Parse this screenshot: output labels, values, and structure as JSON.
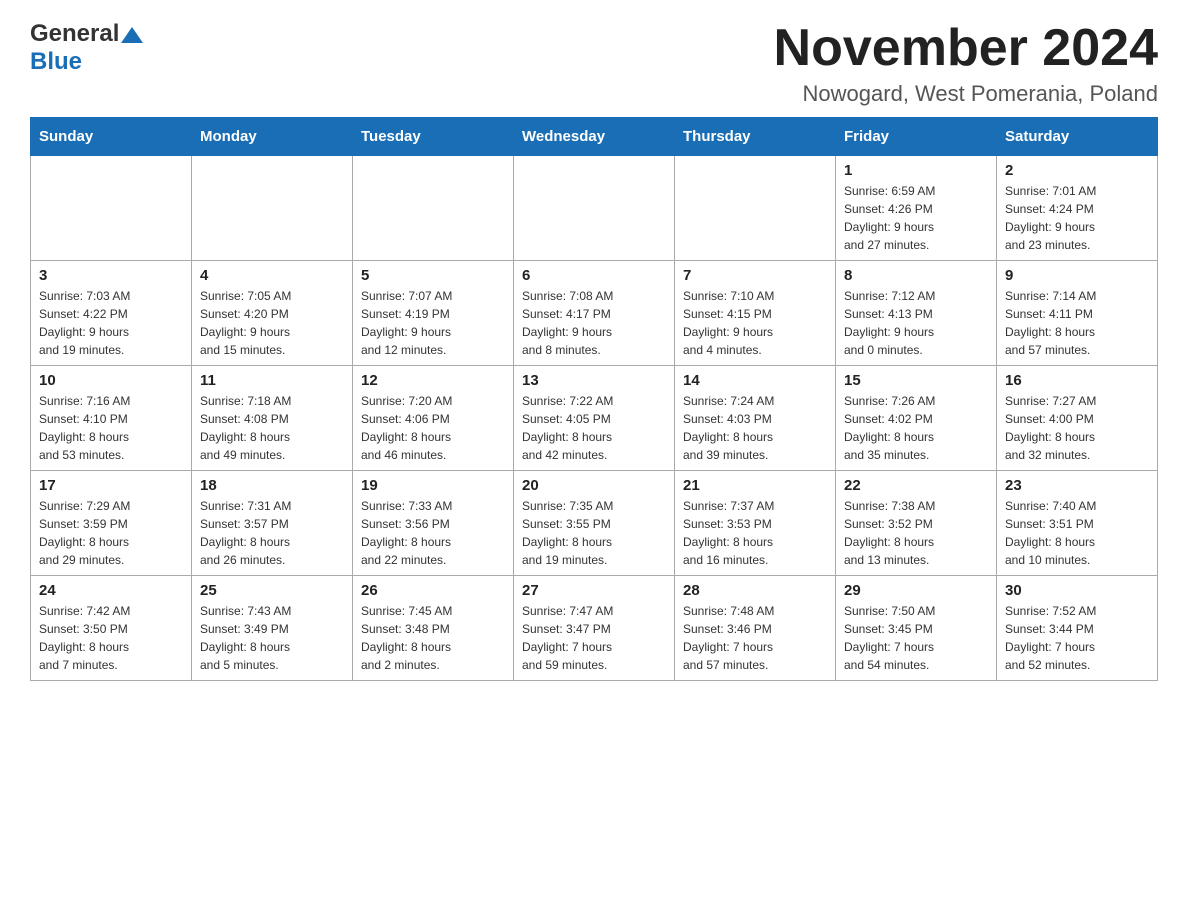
{
  "header": {
    "logo_general": "General",
    "logo_blue": "Blue",
    "main_title": "November 2024",
    "subtitle": "Nowogard, West Pomerania, Poland"
  },
  "weekdays": [
    "Sunday",
    "Monday",
    "Tuesday",
    "Wednesday",
    "Thursday",
    "Friday",
    "Saturday"
  ],
  "weeks": [
    [
      {
        "day": "",
        "info": ""
      },
      {
        "day": "",
        "info": ""
      },
      {
        "day": "",
        "info": ""
      },
      {
        "day": "",
        "info": ""
      },
      {
        "day": "",
        "info": ""
      },
      {
        "day": "1",
        "info": "Sunrise: 6:59 AM\nSunset: 4:26 PM\nDaylight: 9 hours\nand 27 minutes."
      },
      {
        "day": "2",
        "info": "Sunrise: 7:01 AM\nSunset: 4:24 PM\nDaylight: 9 hours\nand 23 minutes."
      }
    ],
    [
      {
        "day": "3",
        "info": "Sunrise: 7:03 AM\nSunset: 4:22 PM\nDaylight: 9 hours\nand 19 minutes."
      },
      {
        "day": "4",
        "info": "Sunrise: 7:05 AM\nSunset: 4:20 PM\nDaylight: 9 hours\nand 15 minutes."
      },
      {
        "day": "5",
        "info": "Sunrise: 7:07 AM\nSunset: 4:19 PM\nDaylight: 9 hours\nand 12 minutes."
      },
      {
        "day": "6",
        "info": "Sunrise: 7:08 AM\nSunset: 4:17 PM\nDaylight: 9 hours\nand 8 minutes."
      },
      {
        "day": "7",
        "info": "Sunrise: 7:10 AM\nSunset: 4:15 PM\nDaylight: 9 hours\nand 4 minutes."
      },
      {
        "day": "8",
        "info": "Sunrise: 7:12 AM\nSunset: 4:13 PM\nDaylight: 9 hours\nand 0 minutes."
      },
      {
        "day": "9",
        "info": "Sunrise: 7:14 AM\nSunset: 4:11 PM\nDaylight: 8 hours\nand 57 minutes."
      }
    ],
    [
      {
        "day": "10",
        "info": "Sunrise: 7:16 AM\nSunset: 4:10 PM\nDaylight: 8 hours\nand 53 minutes."
      },
      {
        "day": "11",
        "info": "Sunrise: 7:18 AM\nSunset: 4:08 PM\nDaylight: 8 hours\nand 49 minutes."
      },
      {
        "day": "12",
        "info": "Sunrise: 7:20 AM\nSunset: 4:06 PM\nDaylight: 8 hours\nand 46 minutes."
      },
      {
        "day": "13",
        "info": "Sunrise: 7:22 AM\nSunset: 4:05 PM\nDaylight: 8 hours\nand 42 minutes."
      },
      {
        "day": "14",
        "info": "Sunrise: 7:24 AM\nSunset: 4:03 PM\nDaylight: 8 hours\nand 39 minutes."
      },
      {
        "day": "15",
        "info": "Sunrise: 7:26 AM\nSunset: 4:02 PM\nDaylight: 8 hours\nand 35 minutes."
      },
      {
        "day": "16",
        "info": "Sunrise: 7:27 AM\nSunset: 4:00 PM\nDaylight: 8 hours\nand 32 minutes."
      }
    ],
    [
      {
        "day": "17",
        "info": "Sunrise: 7:29 AM\nSunset: 3:59 PM\nDaylight: 8 hours\nand 29 minutes."
      },
      {
        "day": "18",
        "info": "Sunrise: 7:31 AM\nSunset: 3:57 PM\nDaylight: 8 hours\nand 26 minutes."
      },
      {
        "day": "19",
        "info": "Sunrise: 7:33 AM\nSunset: 3:56 PM\nDaylight: 8 hours\nand 22 minutes."
      },
      {
        "day": "20",
        "info": "Sunrise: 7:35 AM\nSunset: 3:55 PM\nDaylight: 8 hours\nand 19 minutes."
      },
      {
        "day": "21",
        "info": "Sunrise: 7:37 AM\nSunset: 3:53 PM\nDaylight: 8 hours\nand 16 minutes."
      },
      {
        "day": "22",
        "info": "Sunrise: 7:38 AM\nSunset: 3:52 PM\nDaylight: 8 hours\nand 13 minutes."
      },
      {
        "day": "23",
        "info": "Sunrise: 7:40 AM\nSunset: 3:51 PM\nDaylight: 8 hours\nand 10 minutes."
      }
    ],
    [
      {
        "day": "24",
        "info": "Sunrise: 7:42 AM\nSunset: 3:50 PM\nDaylight: 8 hours\nand 7 minutes."
      },
      {
        "day": "25",
        "info": "Sunrise: 7:43 AM\nSunset: 3:49 PM\nDaylight: 8 hours\nand 5 minutes."
      },
      {
        "day": "26",
        "info": "Sunrise: 7:45 AM\nSunset: 3:48 PM\nDaylight: 8 hours\nand 2 minutes."
      },
      {
        "day": "27",
        "info": "Sunrise: 7:47 AM\nSunset: 3:47 PM\nDaylight: 7 hours\nand 59 minutes."
      },
      {
        "day": "28",
        "info": "Sunrise: 7:48 AM\nSunset: 3:46 PM\nDaylight: 7 hours\nand 57 minutes."
      },
      {
        "day": "29",
        "info": "Sunrise: 7:50 AM\nSunset: 3:45 PM\nDaylight: 7 hours\nand 54 minutes."
      },
      {
        "day": "30",
        "info": "Sunrise: 7:52 AM\nSunset: 3:44 PM\nDaylight: 7 hours\nand 52 minutes."
      }
    ]
  ]
}
